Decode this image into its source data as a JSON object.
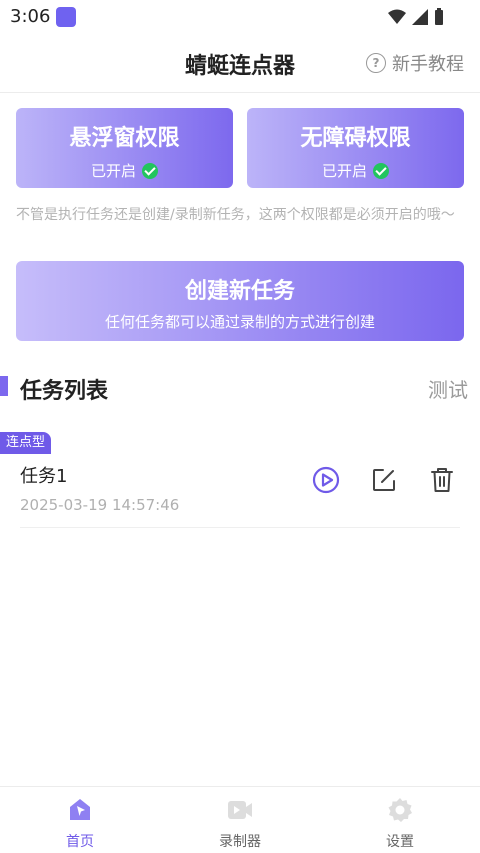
{
  "status_bar": {
    "time": "3:06"
  },
  "header": {
    "title": "蜻蜓连点器",
    "tutorial_label": "新手教程"
  },
  "permissions": [
    {
      "title": "悬浮窗权限",
      "status": "已开启"
    },
    {
      "title": "无障碍权限",
      "status": "已开启"
    }
  ],
  "note": "不管是执行任务还是创建/录制新任务，这两个权限都是必须开启的哦～",
  "create": {
    "title": "创建新任务",
    "subtitle": "任何任务都可以通过录制的方式进行创建"
  },
  "task_list": {
    "title": "任务列表",
    "test_label": "测试",
    "items": [
      {
        "badge": "连点型",
        "name": "任务1",
        "time": "2025-03-19 14:57:46"
      }
    ]
  },
  "bottom_nav": [
    {
      "label": "首页",
      "icon": "home-icon"
    },
    {
      "label": "录制器",
      "icon": "recorder-icon"
    },
    {
      "label": "设置",
      "icon": "settings-icon"
    }
  ],
  "colors": {
    "accent": "#6f5ae8",
    "success": "#22c55e"
  }
}
